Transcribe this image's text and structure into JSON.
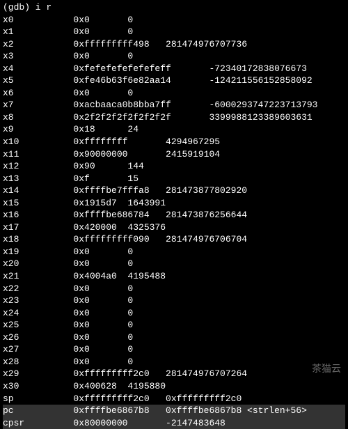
{
  "prompt": "(gdb) i r",
  "registers": [
    {
      "name": "x0",
      "hex": "0x0",
      "dec": "0"
    },
    {
      "name": "x1",
      "hex": "0x0",
      "dec": "0"
    },
    {
      "name": "x2",
      "hex": "0xfffffffff498",
      "dec": "281474976707736"
    },
    {
      "name": "x3",
      "hex": "0x0",
      "dec": "0"
    },
    {
      "name": "x4",
      "hex": "0xfefefefefefefeff",
      "dec": "-72340172838076673"
    },
    {
      "name": "x5",
      "hex": "0xfe46b63f6e82aa14",
      "dec": "-124211556152858092"
    },
    {
      "name": "x6",
      "hex": "0x0",
      "dec": "0"
    },
    {
      "name": "x7",
      "hex": "0xacbaaca0b8bba7ff",
      "dec": "-6000293747223713793"
    },
    {
      "name": "x8",
      "hex": "0x2f2f2f2f2f2f2f2f",
      "dec": "3399988123389603631"
    },
    {
      "name": "x9",
      "hex": "0x18",
      "dec": "24"
    },
    {
      "name": "x10",
      "hex": "0xffffffff",
      "dec": "4294967295"
    },
    {
      "name": "x11",
      "hex": "0x90000000",
      "dec": "2415919104"
    },
    {
      "name": "x12",
      "hex": "0x90",
      "dec": "144"
    },
    {
      "name": "x13",
      "hex": "0xf",
      "dec": "15"
    },
    {
      "name": "x14",
      "hex": "0xffffbe7fffa8",
      "dec": "281473877802920"
    },
    {
      "name": "x15",
      "hex": "0x1915d7",
      "dec": "1643991"
    },
    {
      "name": "x16",
      "hex": "0xffffbe686784",
      "dec": "281473876256644"
    },
    {
      "name": "x17",
      "hex": "0x420000",
      "dec": "4325376"
    },
    {
      "name": "x18",
      "hex": "0xfffffffff090",
      "dec": "281474976706704"
    },
    {
      "name": "x19",
      "hex": "0x0",
      "dec": "0"
    },
    {
      "name": "x20",
      "hex": "0x0",
      "dec": "0"
    },
    {
      "name": "x21",
      "hex": "0x4004a0",
      "dec": "4195488"
    },
    {
      "name": "x22",
      "hex": "0x0",
      "dec": "0"
    },
    {
      "name": "x23",
      "hex": "0x0",
      "dec": "0"
    },
    {
      "name": "x24",
      "hex": "0x0",
      "dec": "0"
    },
    {
      "name": "x25",
      "hex": "0x0",
      "dec": "0"
    },
    {
      "name": "x26",
      "hex": "0x0",
      "dec": "0"
    },
    {
      "name": "x27",
      "hex": "0x0",
      "dec": "0"
    },
    {
      "name": "x28",
      "hex": "0x0",
      "dec": "0"
    },
    {
      "name": "x29",
      "hex": "0xfffffffff2c0",
      "dec": "281474976707264"
    },
    {
      "name": "x30",
      "hex": "0x400628",
      "dec": "4195880"
    },
    {
      "name": "sp",
      "hex": "0xfffffffff2c0",
      "dec": "0xfffffffff2c0"
    }
  ],
  "highlighted": [
    {
      "name": "pc",
      "hex": "0xffffbe6867b8",
      "dec": "0xffffbe6867b8 <strlen+56>"
    },
    {
      "name": "cpsr",
      "hex": "0x80000000",
      "dec": "-2147483648"
    }
  ],
  "watermark": "茶猫云"
}
